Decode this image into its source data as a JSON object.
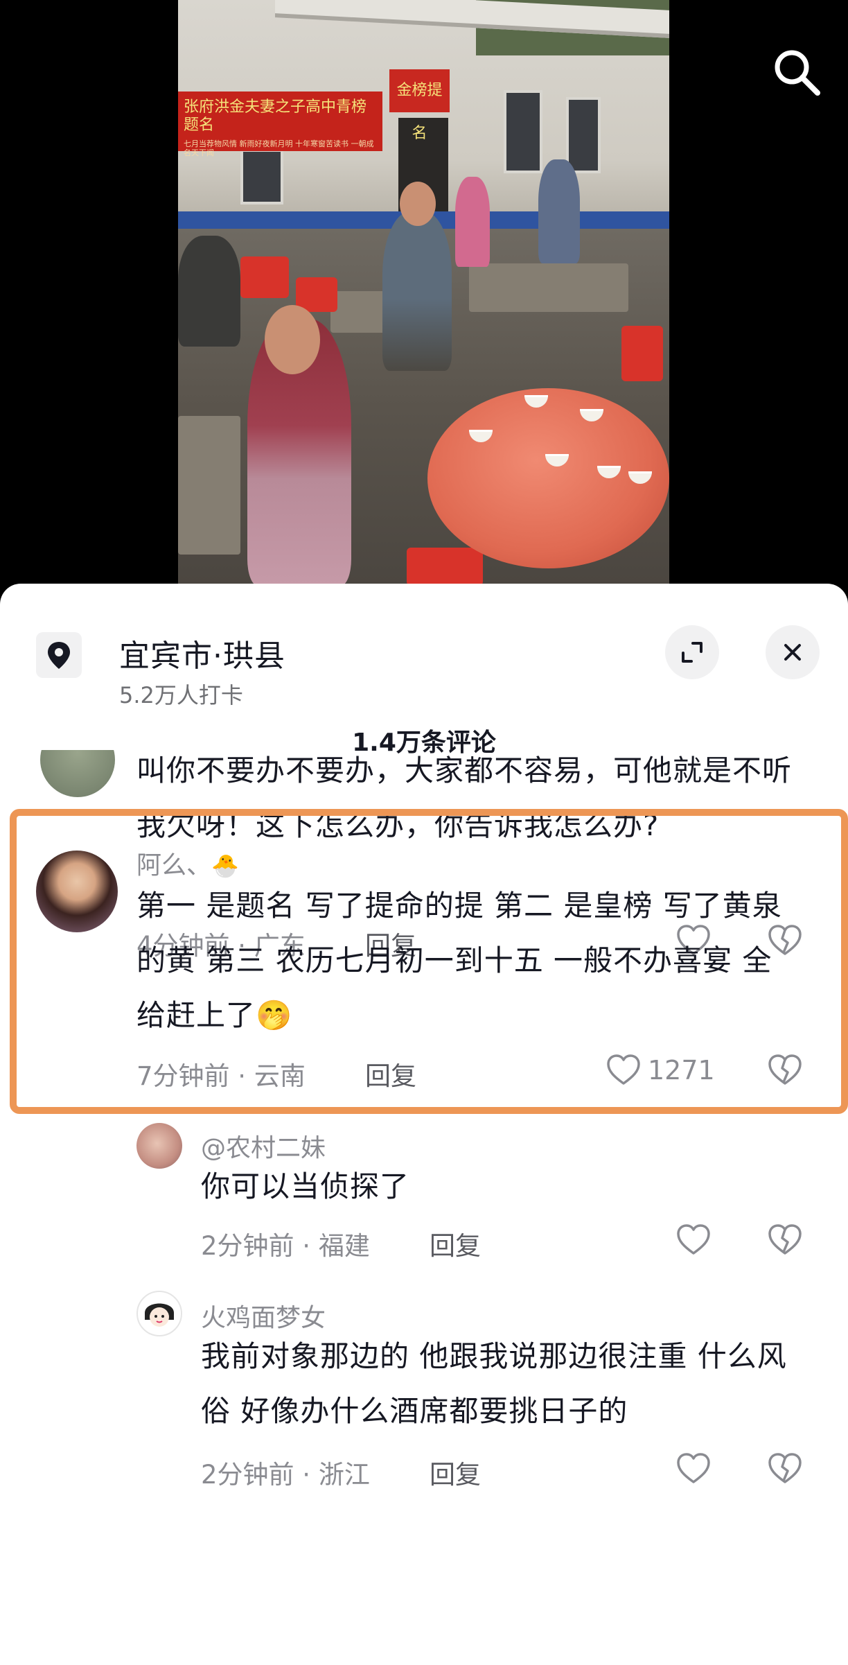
{
  "video": {
    "banner_text": "张府洪金夫妻之子高中青榜题名",
    "banner_subtext": "七月当荐物风情  新雨好夜新月明  十年寒窗苦读书  一朝成名天下闻",
    "sign_text": "金榜提名"
  },
  "location": {
    "title": "宜宾市·珙县",
    "checkins": "5.2万人打卡"
  },
  "comments_header": {
    "title": "1.4万条评论"
  },
  "comments": [
    {
      "text": "叫你不要办不要办，大家都不容易，可他就是不听我欠呀！这下怎么办，你告诉我怎么办?",
      "time": "4分钟前",
      "region": "广东",
      "reply": "回复"
    },
    {
      "name": "阿么、",
      "text": "第一 是题名 写了提命的提 第二 是皇榜 写了黄泉的黄 第三 农历七月初一到十五 一般不办喜宴 全给赶上了🤭",
      "time": "7分钟前",
      "region": "云南",
      "reply": "回复",
      "likes": "1271",
      "highlighted": true
    },
    {
      "name": "@农村二妹",
      "text": "你可以当侦探了",
      "time": "2分钟前",
      "region": "福建",
      "reply": "回复"
    },
    {
      "name": "火鸡面梦女",
      "text": "我前对象那边的 他跟我说那边很注重 什么风俗 好像办什么酒席都要挑日子的",
      "time": "2分钟前",
      "region": "浙江",
      "reply": "回复"
    }
  ],
  "icons": {
    "search": "search-icon",
    "pin": "location-pin-icon",
    "expand": "expand-icon",
    "close": "close-icon",
    "like": "heart-icon",
    "dislike": "broken-heart-icon"
  },
  "colors": {
    "highlight": "#ed9655",
    "text": "#161823",
    "meta": "#8a8b91"
  }
}
